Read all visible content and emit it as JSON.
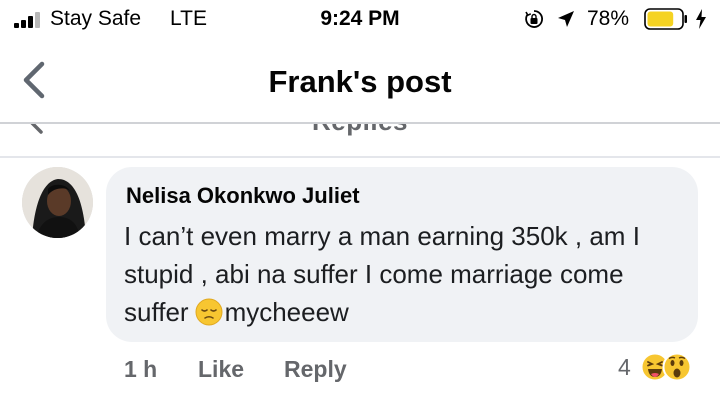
{
  "status_bar": {
    "carrier": "Stay Safe",
    "network": "LTE",
    "time": "9:24 PM",
    "battery_percent": "78%",
    "battery_level": 0.78,
    "battery_color": "#f5d322"
  },
  "header": {
    "title": "Frank's post",
    "back_icon": "chevron-left-icon"
  },
  "replies_bar": {
    "label": "Replies"
  },
  "comment": {
    "author": "Nelisa Okonkwo Juliet",
    "text_before_emoji": "I can’t even marry a man earning 350k , am I stupid , abi na suffer I come marriage come suffer",
    "text_after_emoji": "mycheeew",
    "emoji": "pensive-face-icon",
    "timestamp": "1 h",
    "like_label": "Like",
    "reply_label": "Reply",
    "reaction_count": "4",
    "reactions": [
      "haha-icon",
      "wow-icon"
    ]
  },
  "colors": {
    "bubble_bg": "#f0f2f5",
    "meta_text": "#65676b",
    "divider": "#d0d2d6"
  }
}
